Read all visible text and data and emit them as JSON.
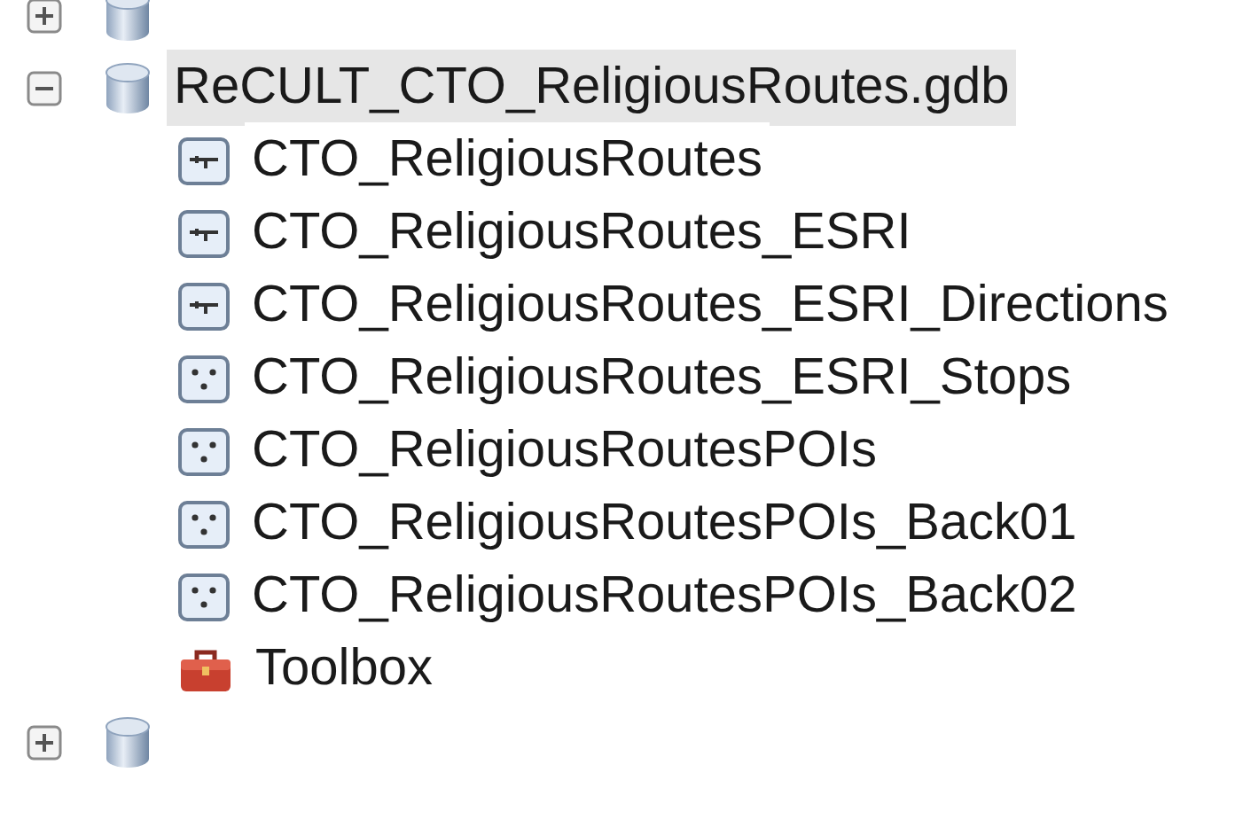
{
  "tree": {
    "items": [
      {
        "kind": "geodatabase",
        "expanded": false
      },
      {
        "kind": "geodatabase",
        "label": "ReCULT_CTO_ReligiousRoutes.gdb",
        "expanded": true,
        "selected": true,
        "children": [
          {
            "kind": "network",
            "label": "CTO_ReligiousRoutes",
            "selected": false
          },
          {
            "kind": "network",
            "label": "CTO_ReligiousRoutes_ESRI",
            "selected": false
          },
          {
            "kind": "network",
            "label": "CTO_ReligiousRoutes_ESRI_Directions",
            "selected": false
          },
          {
            "kind": "points",
            "label": "CTO_ReligiousRoutes_ESRI_Stops",
            "selected": false
          },
          {
            "kind": "points",
            "label": "CTO_ReligiousRoutesPOIs",
            "selected": false
          },
          {
            "kind": "points",
            "label": "CTO_ReligiousRoutesPOIs_Back01",
            "selected": false
          },
          {
            "kind": "points",
            "label": "CTO_ReligiousRoutesPOIs_Back02",
            "selected": false
          },
          {
            "kind": "toolbox",
            "label": "Toolbox",
            "selected": false
          }
        ]
      },
      {
        "kind": "geodatabase",
        "expanded": false
      }
    ]
  }
}
